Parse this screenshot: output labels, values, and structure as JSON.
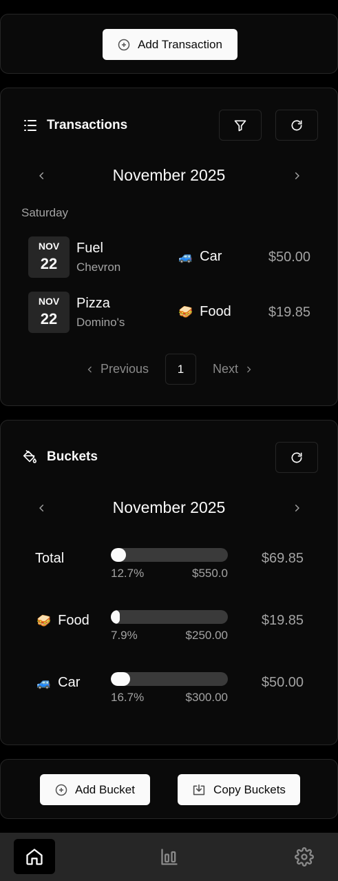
{
  "top_actions": {
    "add_transaction_label": "Add Transaction"
  },
  "transactions": {
    "title": "Transactions",
    "month_label": "November 2025",
    "day_label": "Saturday",
    "items": [
      {
        "month": "NOV",
        "day": "22",
        "name": "Fuel",
        "merchant": "Chevron",
        "category_emoji": "🚙",
        "category": "Car",
        "amount": "$50.00"
      },
      {
        "month": "NOV",
        "day": "22",
        "name": "Pizza",
        "merchant": "Domino's",
        "category_emoji": "🥪",
        "category": "Food",
        "amount": "$19.85"
      }
    ],
    "pagination": {
      "previous_label": "Previous",
      "current_page": "1",
      "next_label": "Next"
    }
  },
  "buckets": {
    "title": "Buckets",
    "month_label": "November 2025",
    "items": [
      {
        "emoji": "",
        "name": "Total",
        "percent": "12.7%",
        "fraction": 0.127,
        "budget": "$550.0",
        "spent": "$69.85"
      },
      {
        "emoji": "🥪",
        "name": "Food",
        "percent": "7.9%",
        "fraction": 0.079,
        "budget": "$250.00",
        "spent": "$19.85"
      },
      {
        "emoji": "🚙",
        "name": "Car",
        "percent": "16.7%",
        "fraction": 0.167,
        "budget": "$300.00",
        "spent": "$50.00"
      }
    ]
  },
  "bucket_actions": {
    "add_bucket_label": "Add Bucket",
    "copy_buckets_label": "Copy Buckets"
  },
  "bottom_nav": {
    "active": "home",
    "items": [
      "home-icon",
      "chart-icon",
      "settings-icon"
    ]
  },
  "colors": {
    "background": "#000000",
    "card": "#0a0a0a",
    "border": "#262626",
    "button_light": "#fafafa",
    "muted_text": "#a3a3a3",
    "progress_track": "#3a3a3a"
  }
}
